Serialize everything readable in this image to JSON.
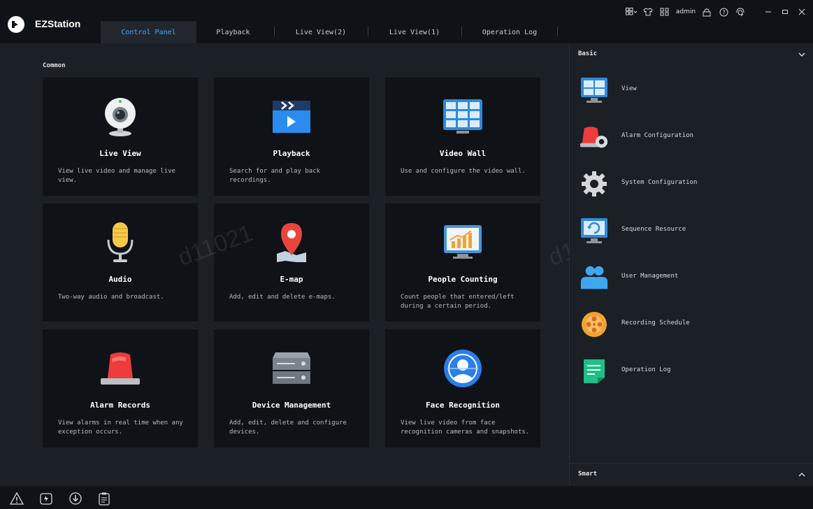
{
  "app": {
    "name": "EZStation"
  },
  "tabs": [
    {
      "label": "Control Panel",
      "active": true
    },
    {
      "label": "Playback",
      "active": false
    },
    {
      "label": "Live View(2)",
      "active": false
    },
    {
      "label": "Live View(1)",
      "active": false
    },
    {
      "label": "Operation Log",
      "active": false
    }
  ],
  "window_controls": {
    "user": "admin",
    "icons": [
      "layout-icon",
      "skin-icon",
      "grid-icon",
      "lock-icon",
      "help-icon",
      "support-icon",
      "minimize-icon",
      "maximize-icon",
      "close-icon"
    ]
  },
  "common": {
    "title": "Common",
    "cards": [
      {
        "title": "Live View",
        "desc": "View live video and manage live view.",
        "icon": "webcam-icon"
      },
      {
        "title": "Playback",
        "desc": "Search for and play back recordings.",
        "icon": "playback-icon"
      },
      {
        "title": "Video Wall",
        "desc": "Use and configure the video wall.",
        "icon": "video-wall-icon"
      },
      {
        "title": "Audio",
        "desc": "Two-way audio and broadcast.",
        "icon": "microphone-icon"
      },
      {
        "title": "E-map",
        "desc": "Add, edit and delete e-maps.",
        "icon": "map-pin-icon"
      },
      {
        "title": "People Counting",
        "desc": "Count people that entered/left during a certain period.",
        "icon": "chart-monitor-icon"
      },
      {
        "title": "Alarm Records",
        "desc": "View alarms in real time when any exception occurs.",
        "icon": "alarm-light-icon"
      },
      {
        "title": "Device Management",
        "desc": "Add, edit, delete and configure devices.",
        "icon": "server-icon"
      },
      {
        "title": "Face Recognition",
        "desc": "View live video from face recognition cameras and snapshots.",
        "icon": "face-icon"
      }
    ]
  },
  "watermark": "d11021",
  "basic": {
    "title": "Basic",
    "items": [
      {
        "label": "View",
        "icon": "view-monitor-icon"
      },
      {
        "label": "Alarm Configuration",
        "icon": "alarm-config-icon"
      },
      {
        "label": "System Configuration",
        "icon": "gear-icon"
      },
      {
        "label": "Sequence Resource",
        "icon": "sequence-icon"
      },
      {
        "label": "User Management",
        "icon": "users-icon"
      },
      {
        "label": "Recording Schedule",
        "icon": "film-reel-icon"
      },
      {
        "label": "Operation Log",
        "icon": "document-icon"
      }
    ]
  },
  "smart": {
    "title": "Smart"
  },
  "bottom_icons": [
    "warning-icon",
    "upgrade-icon",
    "download-icon",
    "clipboard-icon"
  ]
}
